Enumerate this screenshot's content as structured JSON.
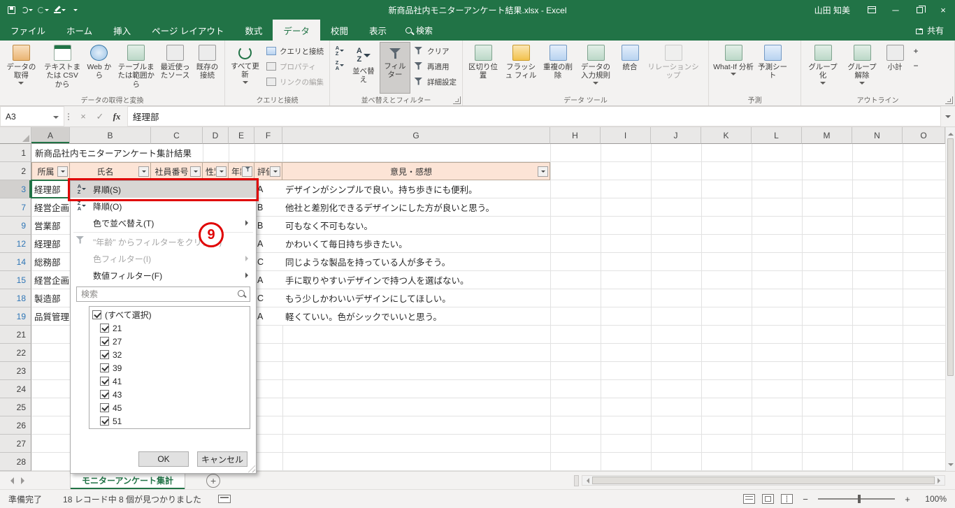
{
  "title_bar": {
    "title": "新商品社内モニターアンケート結果.xlsx  -  Excel",
    "user": "山田 知美"
  },
  "ribbon_tabs": {
    "file": "ファイル",
    "items": [
      "ホーム",
      "挿入",
      "ページ レイアウト",
      "数式",
      "データ",
      "校閲",
      "表示"
    ],
    "tell_me": "検索",
    "share": "共有"
  },
  "ribbon": {
    "groups": [
      {
        "label": "データの取得と変換",
        "items": [
          "データの取得",
          "テキストまたは CSV から",
          "Web から",
          "テーブルまたは範囲から",
          "最近使ったソース",
          "既存の接続"
        ]
      },
      {
        "label": "クエリと接続",
        "big": "すべて更新",
        "small": [
          "クエリと接続",
          "プロパティ",
          "リンクの編集"
        ]
      },
      {
        "label": "並べ替えとフィルター",
        "big": [
          "並べ替え",
          "フィルター"
        ],
        "small": [
          "クリア",
          "再適用",
          "詳細設定"
        ]
      },
      {
        "label": "データ ツール",
        "items": [
          "区切り位置",
          "フラッシュ フィル",
          "重複の削除",
          "データの入力規則",
          "統合",
          "リレーションシップ"
        ]
      },
      {
        "label": "予測",
        "items": [
          "What-If 分析",
          "予測シート"
        ]
      },
      {
        "label": "アウトライン",
        "items": [
          "グループ化",
          "グループ解除",
          "小計"
        ]
      }
    ]
  },
  "formula_bar": {
    "name_box": "A3",
    "fx": "fx",
    "value": "経理部"
  },
  "icons": {
    "sort_a": "A",
    "sort_z": "Z",
    "formula_cancel": "×",
    "formula_enter": "✓",
    "add_sheet": "+",
    "detail_show": "+",
    "detail_hide": "−",
    "zoom_out": "−",
    "zoom_in": "+",
    "minimize": "─",
    "close": "×"
  },
  "sheet": {
    "columns": [
      "A",
      "B",
      "C",
      "D",
      "E",
      "F",
      "G",
      "H",
      "I",
      "J",
      "K",
      "L",
      "M",
      "N",
      "O"
    ],
    "row1_title": "新商品社内モニターアンケート集計結果",
    "headers": [
      "所属",
      "氏名",
      "社員番号",
      "性別",
      "年齢",
      "評価",
      "意見・感想"
    ],
    "gutter_rows": [
      "1",
      "2",
      "3",
      "7",
      "9",
      "12",
      "14",
      "15",
      "18",
      "19",
      "21",
      "22",
      "23",
      "24",
      "25",
      "26",
      "27",
      "28"
    ],
    "rows": [
      {
        "a": "経理部",
        "f": "A",
        "g": "デザインがシンプルで良い。持ち歩きにも便利。"
      },
      {
        "a": "経営企画部",
        "f": "B",
        "g": "他社と差別化できるデザインにした方が良いと思う。"
      },
      {
        "a": "営業部",
        "f": "B",
        "g": "可もなく不可もない。"
      },
      {
        "a": "経理部",
        "f": "A",
        "g": "かわいくて毎日持ち歩きたい。"
      },
      {
        "a": "総務部",
        "f": "C",
        "g": "同じような製品を持っている人が多そう。"
      },
      {
        "a": "経営企画部",
        "f": "A",
        "g": "手に取りやすいデザインで持つ人を選ばない。"
      },
      {
        "a": "製造部",
        "f": "C",
        "g": "もう少しかわいいデザインにしてほしい。"
      },
      {
        "a": "品質管理部",
        "f": "A",
        "g": "軽くていい。色がシックでいいと思う。"
      }
    ]
  },
  "filter_menu": {
    "sort_asc": "昇順(S)",
    "sort_desc": "降順(O)",
    "sort_color": "色で並べ替え(T)",
    "clear": "\"年齢\" からフィルターをクリア(C)",
    "color_filter": "色フィルター(I)",
    "number_filter": "数値フィルター(F)",
    "search_placeholder": "検索",
    "items": [
      "(すべて選択)",
      "21",
      "27",
      "32",
      "39",
      "41",
      "43",
      "45",
      "51"
    ],
    "ok": "OK",
    "cancel": "キャンセル"
  },
  "annotation": {
    "number": "9"
  },
  "sheet_tabs": {
    "active": "モニターアンケート集計"
  },
  "status_bar": {
    "mode": "準備完了",
    "records": "18 レコード中 8 個が見つかりました",
    "zoom": "100%"
  }
}
